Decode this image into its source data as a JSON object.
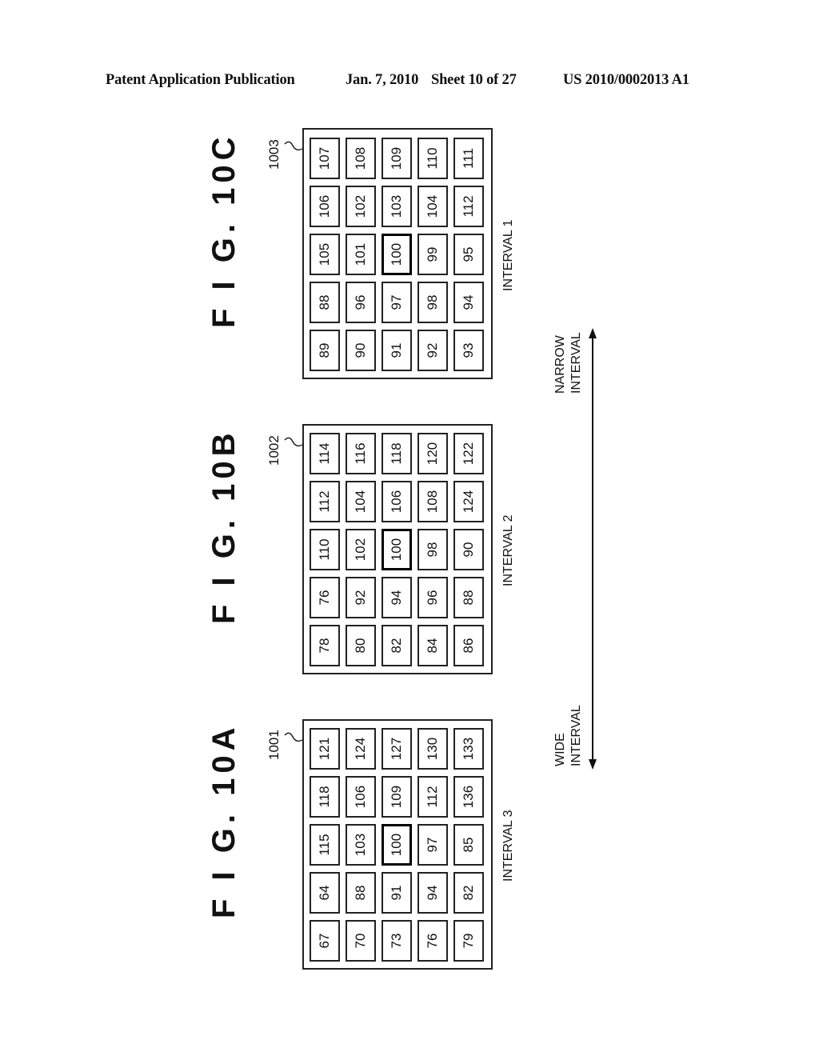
{
  "header": {
    "publication": "Patent Application Publication",
    "date": "Jan. 7, 2010",
    "sheet": "Sheet 10 of 27",
    "number": "US 2010/0002013 A1"
  },
  "figures": [
    {
      "id": "10C",
      "title": "F I G. 10C",
      "ref": "1003",
      "interval_label": "INTERVAL 1",
      "highlight": [
        2,
        2
      ],
      "rows": [
        [
          "107",
          "108",
          "109",
          "110",
          "111"
        ],
        [
          "106",
          "102",
          "103",
          "104",
          "112"
        ],
        [
          "105",
          "101",
          "100",
          "99",
          "95"
        ],
        [
          "88",
          "96",
          "97",
          "98",
          "94"
        ],
        [
          "89",
          "90",
          "91",
          "92",
          "93"
        ]
      ]
    },
    {
      "id": "10B",
      "title": "F I G. 10B",
      "ref": "1002",
      "interval_label": "INTERVAL 2",
      "highlight": [
        2,
        2
      ],
      "rows": [
        [
          "114",
          "116",
          "118",
          "120",
          "122"
        ],
        [
          "112",
          "104",
          "106",
          "108",
          "124"
        ],
        [
          "110",
          "102",
          "100",
          "98",
          "90"
        ],
        [
          "76",
          "92",
          "94",
          "96",
          "88"
        ],
        [
          "78",
          "80",
          "82",
          "84",
          "86"
        ]
      ]
    },
    {
      "id": "10A",
      "title": "F I G. 10A",
      "ref": "1001",
      "interval_label": "INTERVAL 3",
      "highlight": [
        2,
        2
      ],
      "rows": [
        [
          "121",
          "124",
          "127",
          "130",
          "133"
        ],
        [
          "118",
          "106",
          "109",
          "112",
          "136"
        ],
        [
          "115",
          "103",
          "100",
          "97",
          "85"
        ],
        [
          "64",
          "88",
          "91",
          "94",
          "82"
        ],
        [
          "67",
          "70",
          "73",
          "76",
          "79"
        ]
      ]
    }
  ],
  "arrow": {
    "top_label_line1": "NARROW",
    "top_label_line2": "INTERVAL",
    "bottom_label_line1": "WIDE",
    "bottom_label_line2": "INTERVAL"
  }
}
